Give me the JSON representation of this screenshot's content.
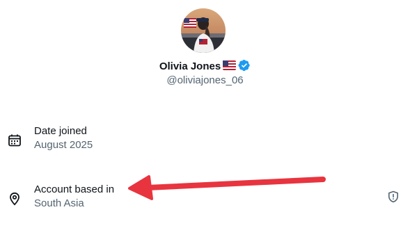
{
  "profile": {
    "display_name": "Olivia Jones",
    "handle": "@oliviajones_06",
    "avatar_icon": "profile-photo",
    "flag_icon": "us-flag-emoji",
    "verified_icon": "verified-badge-icon"
  },
  "about": {
    "joined_label": "Date joined",
    "joined_value": "August 2025",
    "location_label": "Account based in",
    "location_value": "South Asia"
  },
  "colors": {
    "verified_blue": "#1d9bf0",
    "secondary_text": "#536471",
    "primary_text": "#0f1419",
    "annotation_arrow": "#e8343f"
  }
}
